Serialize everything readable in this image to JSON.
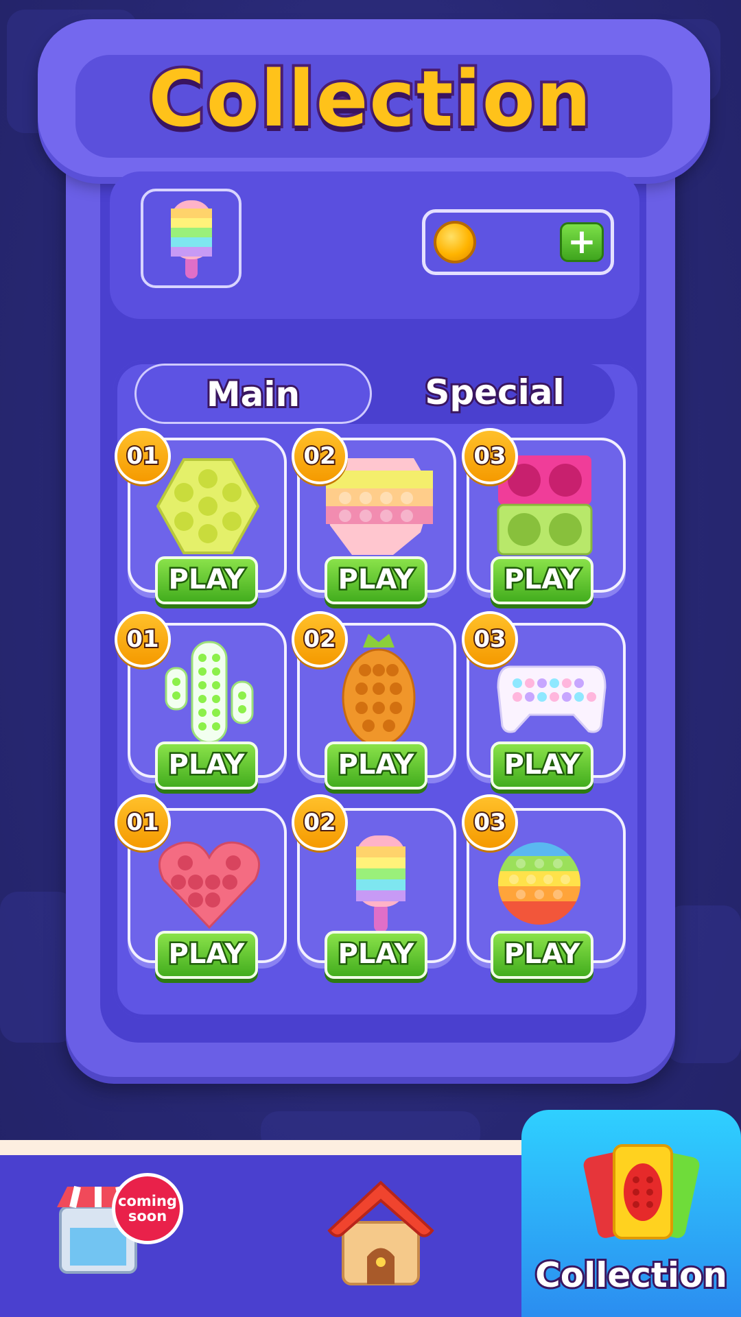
{
  "screen": {
    "title": "Collection"
  },
  "resources": {
    "coin_value": "",
    "plus_label": "+"
  },
  "tabs": [
    {
      "label": "Main",
      "active": true
    },
    {
      "label": "Special",
      "active": false
    }
  ],
  "grid": {
    "play_label": "PLAY",
    "items": [
      {
        "number": "01",
        "toy": "hexagon-pop-it-icon"
      },
      {
        "number": "02",
        "toy": "rainbow-octagon-pop-it-icon"
      },
      {
        "number": "03",
        "toy": "square-pop-it-icon"
      },
      {
        "number": "01",
        "toy": "cactus-pop-it-icon"
      },
      {
        "number": "02",
        "toy": "pineapple-pop-it-icon"
      },
      {
        "number": "03",
        "toy": "gamepad-pop-it-icon"
      },
      {
        "number": "01",
        "toy": "heart-pop-it-icon"
      },
      {
        "number": "02",
        "toy": "popsicle-pop-it-icon"
      },
      {
        "number": "03",
        "toy": "rainbow-circle-pop-it-icon"
      }
    ]
  },
  "bottom_nav": {
    "shop_badge": "coming soon",
    "shop_badge_line1": "coming",
    "shop_badge_line2": "soon",
    "active_label": "Collection"
  },
  "colors": {
    "panel": "#6a5fe6",
    "title": "#ffc21a",
    "play": "#43ad1e",
    "badge": "#f59a00",
    "nav_active": "#2b8df0"
  }
}
